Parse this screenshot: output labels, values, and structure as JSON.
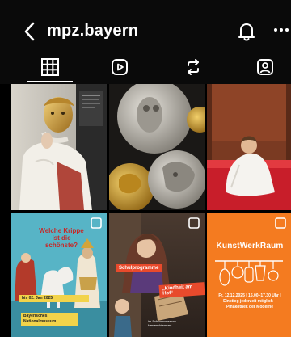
{
  "header": {
    "title": "mpz.bayern",
    "back_icon": "chevron-left-icon",
    "bell_icon": "bell-icon",
    "more_icon": "more-horizontal-icon"
  },
  "tabs": [
    {
      "name": "grid",
      "icon": "grid-icon",
      "active": true
    },
    {
      "name": "reels",
      "icon": "reels-icon",
      "active": false
    },
    {
      "name": "reposts",
      "icon": "repost-icon",
      "active": false
    },
    {
      "name": "tagged",
      "icon": "tagged-icon",
      "active": false
    }
  ],
  "posts": [
    {
      "id": "p1",
      "subject": "gilded-mask-figure"
    },
    {
      "id": "p2",
      "subject": "ancient-coins"
    },
    {
      "id": "p3",
      "subject": "person-on-red-bed"
    },
    {
      "id": "p4",
      "subject": "nativity-figures",
      "title": "Welche Krippe ist die schönste?",
      "banner_1": "bis 02. Jan 2025",
      "banner_2": "Bayerisches Nationalmuseum",
      "multi": true
    },
    {
      "id": "p5",
      "subject": "girl-with-easel",
      "tag_1": "Schulprogramme",
      "tag_2": "„Kindheit am Hof“",
      "caption": "im Schlossmuseum Herrenchiemsee",
      "multi": true
    },
    {
      "id": "p6",
      "subject": "kunstwerkraum-poster",
      "title": "KunstWerkRaum",
      "subtitle": "Fr. 12.12.2025 | 15.00–17.30 Uhr | Einstieg jederzeit möglich – Pinakothek der Moderne",
      "multi": true
    }
  ],
  "colors": {
    "background": "#000000",
    "header_bg": "#0a0a0a",
    "icon": "#ffffff",
    "kunstwerk_orange": "#f47b20"
  }
}
